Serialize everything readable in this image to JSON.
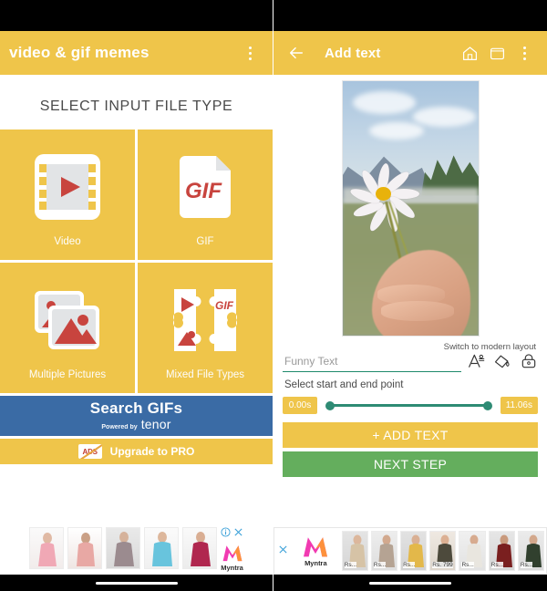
{
  "left_screen": {
    "appbar": {
      "title": "video & gif memes",
      "menu_icon": "kebab-menu-icon"
    },
    "section_title": "SELECT INPUT FILE TYPE",
    "tiles": [
      {
        "label": "Video",
        "icon": "film-strip-play-icon"
      },
      {
        "label": "GIF",
        "icon": "gif-file-icon"
      },
      {
        "label": "Multiple Pictures",
        "icon": "multiple-pictures-icon"
      },
      {
        "label": "Mixed File Types",
        "icon": "puzzle-mixed-types-icon"
      }
    ],
    "search_gifs": {
      "title": "Search GIFs",
      "powered_by": "Powered by",
      "provider": "tenor",
      "color": "#3A6BA5"
    },
    "upgrade": {
      "badge": "ADS",
      "label": "Upgrade to PRO"
    },
    "ad": {
      "brand": "Myntra",
      "info_icon": "info-icon",
      "close_icon": "close-icon"
    }
  },
  "right_screen": {
    "appbar": {
      "back_icon": "back-arrow-icon",
      "title": "Add text",
      "home_icon": "home-icon",
      "window_icon": "window-icon",
      "menu_icon": "kebab-menu-icon"
    },
    "preview": {
      "alt": "hand holding white daisy flower in a field"
    },
    "switch_layout": "Switch to modern layout",
    "text_field": {
      "placeholder": "Funny Text",
      "value": ""
    },
    "tools": [
      {
        "name": "font-style-icon"
      },
      {
        "name": "paint-bucket-icon"
      },
      {
        "name": "lock-icon"
      }
    ],
    "range_hint": "Select start and end point",
    "range": {
      "start": "0.00s",
      "end": "11.06s",
      "accent": "#2E8B74"
    },
    "buttons": [
      {
        "label": "+ ADD TEXT",
        "color": "#EFC54A"
      },
      {
        "label": "NEXT STEP",
        "color": "#64AE5D"
      }
    ],
    "ad": {
      "brand": "Myntra",
      "close_icon": "close-icon",
      "prices": [
        "Rs...",
        "Rs...",
        "Rs...",
        "Rs. 799",
        "Rs...",
        "Rs...",
        "Rs..."
      ]
    }
  },
  "theme": {
    "primary": "#EFC54A",
    "green": "#64AE5D",
    "teal": "#2E8B74",
    "blue": "#3A6BA5"
  }
}
